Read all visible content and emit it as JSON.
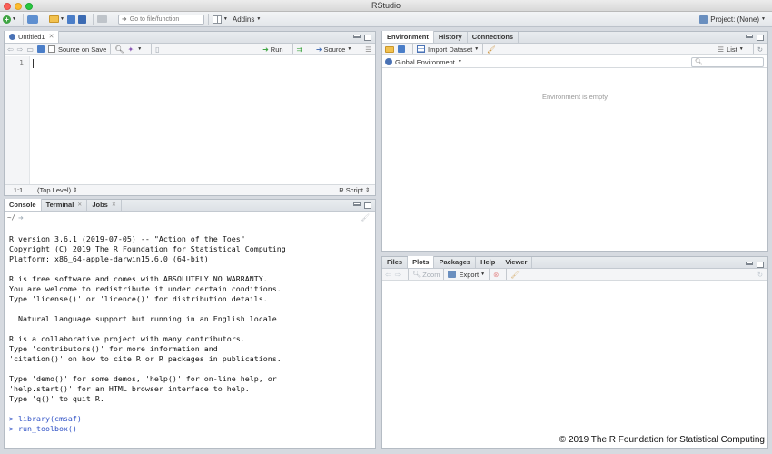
{
  "window": {
    "title": "RStudio"
  },
  "toolbar": {
    "go_to_file_placeholder": "Go to file/function",
    "addins_label": "Addins",
    "project_label": "Project: (None)"
  },
  "editor": {
    "tab_label": "Untitled1",
    "source_on_save_label": "Source on Save",
    "run_label": "Run",
    "source_label": "Source",
    "line_number": "1",
    "status_position": "1:1",
    "status_scope": "(Top Level)",
    "status_type": "R Script"
  },
  "console_pane": {
    "tabs": [
      {
        "label": "Console"
      },
      {
        "label": "Terminal"
      },
      {
        "label": "Jobs"
      }
    ],
    "path": "~/",
    "lines": [
      "R version 3.6.1 (2019-07-05) -- \"Action of the Toes\"",
      "Copyright (C) 2019 The R Foundation for Statistical Computing",
      "Platform: x86_64-apple-darwin15.6.0 (64-bit)",
      "",
      "R is free software and comes with ABSOLUTELY NO WARRANTY.",
      "You are welcome to redistribute it under certain conditions.",
      "Type 'license()' or 'licence()' for distribution details.",
      "",
      "  Natural language support but running in an English locale",
      "",
      "R is a collaborative project with many contributors.",
      "Type 'contributors()' for more information and",
      "'citation()' on how to cite R or R packages in publications.",
      "",
      "Type 'demo()' for some demos, 'help()' for on-line help, or",
      "'help.start()' for an HTML browser interface to help.",
      "Type 'q()' to quit R.",
      ""
    ],
    "commands": [
      "> library(cmsaf)",
      "> run_toolbox()"
    ]
  },
  "env_pane": {
    "tabs": [
      {
        "label": "Environment"
      },
      {
        "label": "History"
      },
      {
        "label": "Connections"
      }
    ],
    "import_dataset_label": "Import Dataset",
    "list_label": "List",
    "global_env_label": "Global Environment",
    "empty_message": "Environment is empty"
  },
  "files_pane": {
    "tabs": [
      {
        "label": "Files"
      },
      {
        "label": "Plots"
      },
      {
        "label": "Packages"
      },
      {
        "label": "Help"
      },
      {
        "label": "Viewer"
      }
    ],
    "zoom_label": "Zoom",
    "export_label": "Export"
  },
  "watermark": "© 2019 The R Foundation for Statistical Computing",
  "colors": {
    "accent": "#4a72b5",
    "prompt": "#3052c6"
  }
}
